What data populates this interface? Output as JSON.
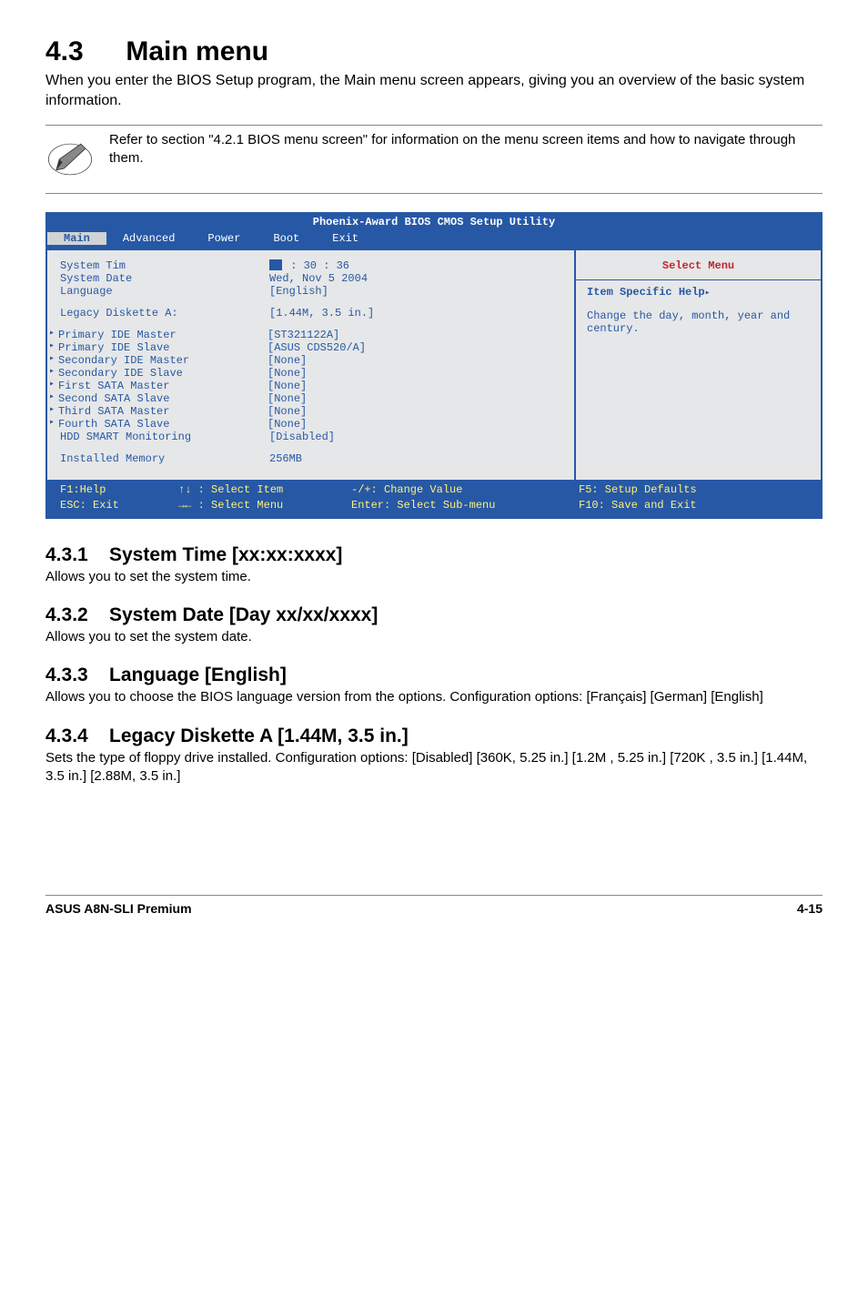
{
  "heading": {
    "number": "4.3",
    "title": "Main menu"
  },
  "intro": "When you enter the BIOS Setup program, the Main menu screen appears, giving you an overview of the basic system information.",
  "note": "Refer to section \"4.2.1  BIOS menu screen\" for information on the menu screen items and how to navigate through them.",
  "bios": {
    "title": "Phoenix-Award BIOS CMOS Setup Utility",
    "menubar": [
      "Main",
      "Advanced",
      "Power",
      "Boot",
      "Exit"
    ],
    "rows": [
      {
        "label": "System Tim",
        "value": " : 30 : 36"
      },
      {
        "label": "System Date",
        "value": "Wed, Nov 5 2004"
      },
      {
        "label": "Language",
        "value": "[English]"
      }
    ],
    "legacy": {
      "label": "Legacy Diskette A:",
      "value": "[1.44M, 3.5 in.]"
    },
    "subrows": [
      {
        "label": "Primary IDE Master",
        "value": "[ST321122A]"
      },
      {
        "label": "Primary IDE Slave",
        "value": "[ASUS CDS520/A]"
      },
      {
        "label": "Secondary IDE Master",
        "value": "[None]"
      },
      {
        "label": "Secondary IDE Slave",
        "value": "[None]"
      },
      {
        "label": "First SATA Master",
        "value": "[None]"
      },
      {
        "label": "Second SATA Slave",
        "value": "[None]"
      },
      {
        "label": "Third SATA Master",
        "value": "[None]"
      },
      {
        "label": "Fourth SATA Slave",
        "value": "[None]"
      }
    ],
    "hdd": {
      "label": "HDD SMART Monitoring",
      "value": "[Disabled]"
    },
    "mem": {
      "label": "Installed Memory",
      "value": "256MB"
    },
    "help": {
      "select_menu": "Select Menu",
      "item_specific": "Item Specific Help",
      "msg": "Change the day, month, year and century."
    },
    "footer": {
      "l1a": "F1:Help",
      "l1b": "↑↓ : Select Item",
      "l1c": "-/+: Change Value",
      "l1d": "F5: Setup Defaults",
      "l2a": "ESC: Exit",
      "l2b": "→← : Select Menu",
      "l2c": "Enter: Select Sub-menu",
      "l2d": "F10: Save and Exit"
    }
  },
  "sections": [
    {
      "num": "4.3.1",
      "title": "System Time [xx:xx:xxxx]",
      "body": "Allows you to set the system time."
    },
    {
      "num": "4.3.2",
      "title": "System Date [Day xx/xx/xxxx]",
      "body": "Allows you to set the system date."
    },
    {
      "num": "4.3.3",
      "title": "Language [English]",
      "body": "Allows you to choose the BIOS language version from the options. Configuration options: [Français] [German] [English]"
    },
    {
      "num": "4.3.4",
      "title": "Legacy Diskette A [1.44M, 3.5 in.]",
      "body": "Sets the type of floppy drive installed. Configuration options: [Disabled] [360K, 5.25 in.] [1.2M , 5.25 in.] [720K , 3.5 in.] [1.44M, 3.5 in.] [2.88M, 3.5 in.]"
    }
  ],
  "footer": {
    "left": "ASUS A8N-SLI Premium",
    "right": "4-15"
  }
}
